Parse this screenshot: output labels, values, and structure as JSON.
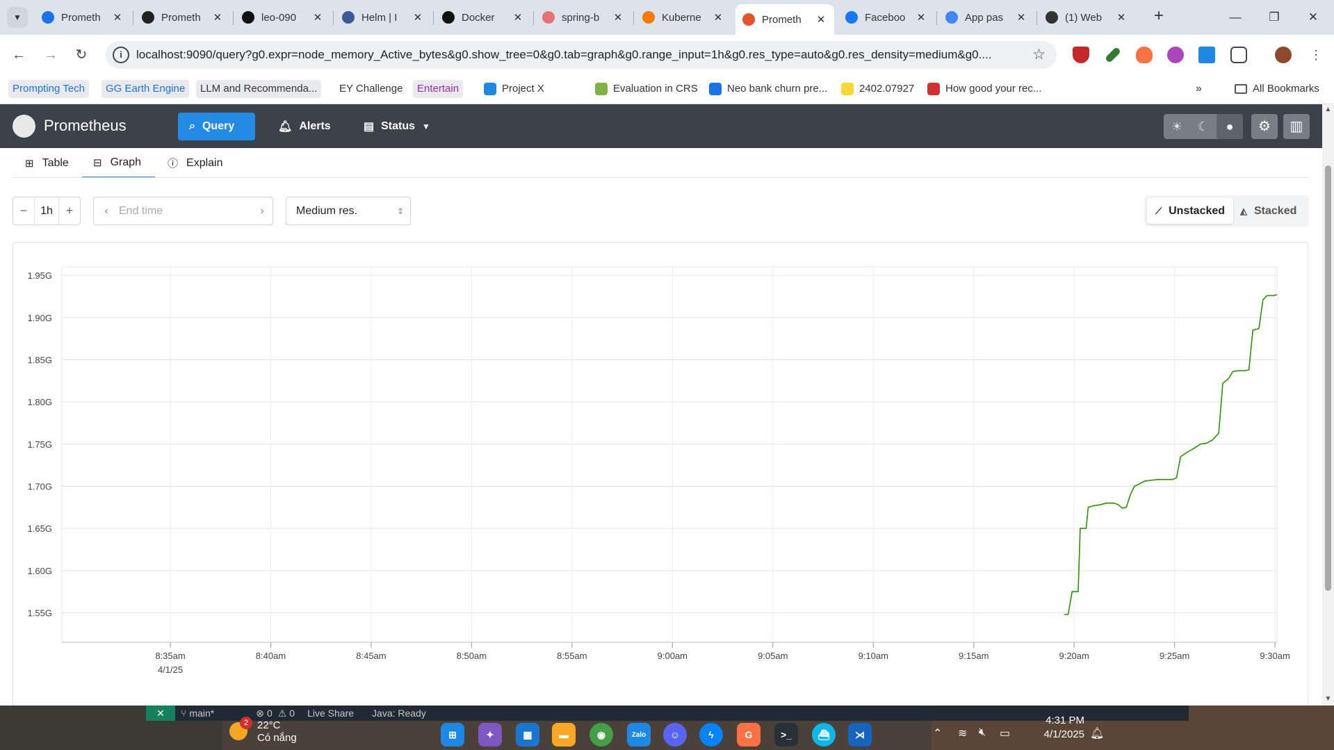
{
  "browser": {
    "tabs": [
      {
        "title": "Prometh",
        "color": "#1a73e8",
        "active": false
      },
      {
        "title": "Prometh",
        "color": "#222222",
        "active": false
      },
      {
        "title": "leo-090",
        "color": "#111111",
        "active": false
      },
      {
        "title": "Helm | I",
        "color": "#3b5998",
        "active": false
      },
      {
        "title": "Docker",
        "color": "#111111",
        "active": false
      },
      {
        "title": "spring-b",
        "color": "#e57373",
        "active": false
      },
      {
        "title": "Kuberne",
        "color": "#f57c00",
        "active": false
      },
      {
        "title": "Prometh",
        "color": "#e6522c",
        "active": true
      },
      {
        "title": "Faceboo",
        "color": "#1877f2",
        "active": false
      },
      {
        "title": "App pas",
        "color": "#4285f4",
        "active": false
      },
      {
        "title": "(1) Web",
        "color": "#333333",
        "active": false
      }
    ],
    "new_tab_label": "+",
    "url": "localhost:9090/query?g0.expr=node_memory_Active_bytes&g0.show_tree=0&g0.tab=graph&g0.range_input=1h&g0.res_type=auto&g0.res_density=medium&g0....",
    "bookmarks": [
      {
        "label": "Prompting Tech",
        "color": "#1a73e8",
        "highlight": true
      },
      {
        "label": "GG Earth Engine",
        "color": "#1a73e8",
        "highlight": true
      },
      {
        "label": "LLM and Recommenda...",
        "color": "#333333",
        "highlight": true
      },
      {
        "label": "EY Challenge",
        "color": "#333333",
        "highlight": false
      },
      {
        "label": "Entertain",
        "color": "#9c27b0",
        "highlight": true
      },
      {
        "label": "Project X",
        "color": "#333333",
        "highlight": false
      },
      {
        "label": "Evaluation in CRS",
        "color": "#333333",
        "highlight": false
      },
      {
        "label": "Neo bank churn pre...",
        "color": "#333333",
        "highlight": false
      },
      {
        "label": "2402.07927",
        "color": "#333333",
        "highlight": false
      },
      {
        "label": "How good your rec...",
        "color": "#333333",
        "highlight": false
      }
    ],
    "all_bookmarks": "All Bookmarks"
  },
  "prometheus": {
    "brand": "Prometheus",
    "nav": {
      "query": "Query",
      "alerts": "Alerts",
      "status": "Status"
    },
    "panel_tabs": {
      "table": "Table",
      "graph": "Graph",
      "explain": "Explain"
    },
    "range": "1h",
    "end_time_placeholder": "End time",
    "resolution": "Medium res.",
    "stack_options": {
      "unstacked": "Unstacked",
      "stacked": "Stacked"
    },
    "accent": "#228be6"
  },
  "chart_data": {
    "type": "line",
    "ylabel": "",
    "xlabel": "",
    "y_ticks": [
      "1.55G",
      "1.60G",
      "1.65G",
      "1.70G",
      "1.75G",
      "1.80G",
      "1.85G",
      "1.90G",
      "1.95G"
    ],
    "ylim": [
      1.515,
      1.96
    ],
    "x_ticks": [
      "8:35am",
      "8:40am",
      "8:45am",
      "8:50am",
      "8:55am",
      "9:00am",
      "9:05am",
      "9:10am",
      "9:15am",
      "9:20am",
      "9:25am",
      "9:30am"
    ],
    "x_date_label": "4/1/25",
    "xlim_minutes": [
      -5.4,
      55.1
    ],
    "series": [
      {
        "color": "#2b9200",
        "points_minutes_since_835": [
          [
            44.5,
            1.548
          ],
          [
            44.7,
            1.548
          ],
          [
            44.9,
            1.575
          ],
          [
            45.1,
            1.575
          ],
          [
            45.2,
            1.575
          ],
          [
            45.3,
            1.65
          ],
          [
            45.6,
            1.65
          ],
          [
            45.7,
            1.675
          ],
          [
            46.0,
            1.677
          ],
          [
            46.3,
            1.678
          ],
          [
            46.6,
            1.68
          ],
          [
            47.0,
            1.68
          ],
          [
            47.2,
            1.678
          ],
          [
            47.4,
            1.674
          ],
          [
            47.6,
            1.675
          ],
          [
            47.8,
            1.69
          ],
          [
            48.0,
            1.7
          ],
          [
            48.2,
            1.702
          ],
          [
            48.5,
            1.706
          ],
          [
            48.8,
            1.707
          ],
          [
            49.2,
            1.708
          ],
          [
            49.5,
            1.708
          ],
          [
            49.9,
            1.708
          ],
          [
            50.1,
            1.71
          ],
          [
            50.3,
            1.735
          ],
          [
            50.6,
            1.74
          ],
          [
            50.9,
            1.744
          ],
          [
            51.3,
            1.75
          ],
          [
            51.6,
            1.751
          ],
          [
            51.9,
            1.755
          ],
          [
            52.2,
            1.763
          ],
          [
            52.4,
            1.822
          ],
          [
            52.7,
            1.828
          ],
          [
            52.9,
            1.836
          ],
          [
            53.2,
            1.837
          ],
          [
            53.5,
            1.837
          ],
          [
            53.7,
            1.838
          ],
          [
            53.9,
            1.885
          ],
          [
            54.2,
            1.887
          ],
          [
            54.4,
            1.921
          ],
          [
            54.6,
            1.926
          ],
          [
            54.9,
            1.926
          ],
          [
            55.1,
            1.927
          ]
        ]
      }
    ]
  },
  "taskbar": {
    "vscode_branch": "main*",
    "vscode_errors": "0",
    "vscode_warnings": "0",
    "vscode_liveshare": "Live Share",
    "vscode_java": "Java: Ready",
    "weather_temp": "22°C",
    "weather_desc": "Có nắng",
    "weather_badge": "2",
    "time": "4:31 PM",
    "date": "4/1/2025"
  }
}
